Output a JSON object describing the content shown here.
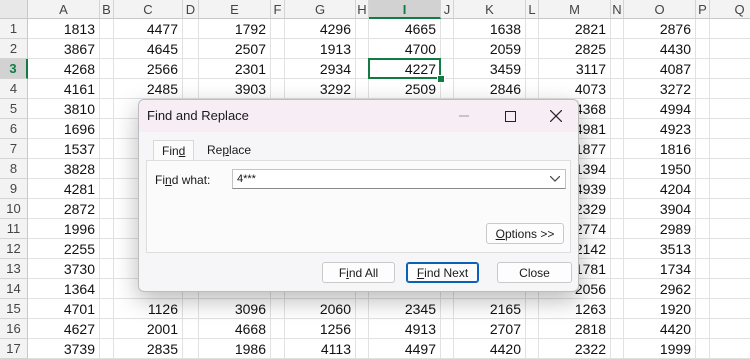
{
  "sheet": {
    "columns": [
      "A",
      "B",
      "C",
      "D",
      "E",
      "F",
      "G",
      "H",
      "I",
      "J",
      "K",
      "L",
      "M",
      "N",
      "O",
      "P",
      "Q"
    ],
    "selected_column": "I",
    "selected_row": "3",
    "rows": [
      {
        "num": "1",
        "A": "1813",
        "C": "4477",
        "E": "1792",
        "G": "4296",
        "I": "4665",
        "K": "1638",
        "M": "2821",
        "O": "2876",
        "Q": "4"
      },
      {
        "num": "2",
        "A": "3867",
        "C": "4645",
        "E": "2507",
        "G": "1913",
        "I": "4700",
        "K": "2059",
        "M": "2825",
        "O": "4430",
        "Q": "4"
      },
      {
        "num": "3",
        "A": "4268",
        "C": "2566",
        "E": "2301",
        "G": "2934",
        "I": "4227",
        "K": "3459",
        "M": "3117",
        "O": "4087",
        "Q": "4"
      },
      {
        "num": "4",
        "A": "4161",
        "C": "2485",
        "E": "3903",
        "G": "3292",
        "I": "2509",
        "K": "2846",
        "M": "4073",
        "O": "3272",
        "Q": "3"
      },
      {
        "num": "5",
        "A": "3810",
        "C": "",
        "E": "",
        "G": "",
        "I": "",
        "K": "",
        "M": "4368",
        "O": "4994",
        "Q": "2"
      },
      {
        "num": "6",
        "A": "1696",
        "C": "",
        "E": "",
        "G": "",
        "I": "",
        "K": "",
        "M": "4981",
        "O": "4923",
        "Q": "4"
      },
      {
        "num": "7",
        "A": "1537",
        "C": "",
        "E": "",
        "G": "",
        "I": "",
        "K": "",
        "M": "1877",
        "O": "1816",
        "Q": "1"
      },
      {
        "num": "8",
        "A": "3828",
        "C": "",
        "E": "",
        "G": "",
        "I": "",
        "K": "",
        "M": "1394",
        "O": "1950",
        "Q": "3"
      },
      {
        "num": "9",
        "A": "4281",
        "C": "",
        "E": "",
        "G": "",
        "I": "",
        "K": "",
        "M": "4939",
        "O": "4204",
        "Q": "1"
      },
      {
        "num": "10",
        "A": "2872",
        "C": "",
        "E": "",
        "G": "",
        "I": "",
        "K": "",
        "M": "2329",
        "O": "3904",
        "Q": "2"
      },
      {
        "num": "11",
        "A": "1996",
        "C": "",
        "E": "",
        "G": "",
        "I": "",
        "K": "",
        "M": "2774",
        "O": "2989",
        "Q": "2"
      },
      {
        "num": "12",
        "A": "2255",
        "C": "",
        "E": "",
        "G": "",
        "I": "",
        "K": "",
        "M": "2142",
        "O": "3513",
        "Q": "2"
      },
      {
        "num": "13",
        "A": "3730",
        "C": "",
        "E": "",
        "G": "",
        "I": "",
        "K": "",
        "M": "1781",
        "O": "1734",
        "Q": "4"
      },
      {
        "num": "14",
        "A": "1364",
        "C": "",
        "E": "",
        "G": "",
        "I": "",
        "K": "",
        "M": "2056",
        "O": "2962",
        "Q": "4"
      },
      {
        "num": "15",
        "A": "4701",
        "C": "1126",
        "E": "3096",
        "G": "2060",
        "I": "2345",
        "K": "2165",
        "M": "1263",
        "O": "1920",
        "Q": "4"
      },
      {
        "num": "16",
        "A": "4627",
        "C": "2001",
        "E": "4668",
        "G": "1256",
        "I": "4913",
        "K": "2707",
        "M": "2818",
        "O": "4420",
        "Q": "4"
      },
      {
        "num": "17",
        "A": "3739",
        "C": "2835",
        "E": "1986",
        "G": "4113",
        "I": "4497",
        "K": "4420",
        "M": "2322",
        "O": "1999",
        "Q": "2"
      }
    ]
  },
  "dialog": {
    "title": "Find and Replace",
    "tabs": [
      {
        "label": "Find",
        "underline": "d",
        "active": true
      },
      {
        "label": "Replace",
        "underline": "p",
        "active": false
      }
    ],
    "find_label": "Find what:",
    "find_value": "4***",
    "options_label": "Options >>",
    "find_all_label": "Find All",
    "find_next_label": "Find Next",
    "close_label": "Close"
  },
  "icons": {
    "minimize": "minimize-icon",
    "maximize": "maximize-icon",
    "close": "close-icon",
    "dropdown": "chevron-down-icon"
  },
  "colors": {
    "accent": "#107c41",
    "focus": "#0a62b8"
  }
}
